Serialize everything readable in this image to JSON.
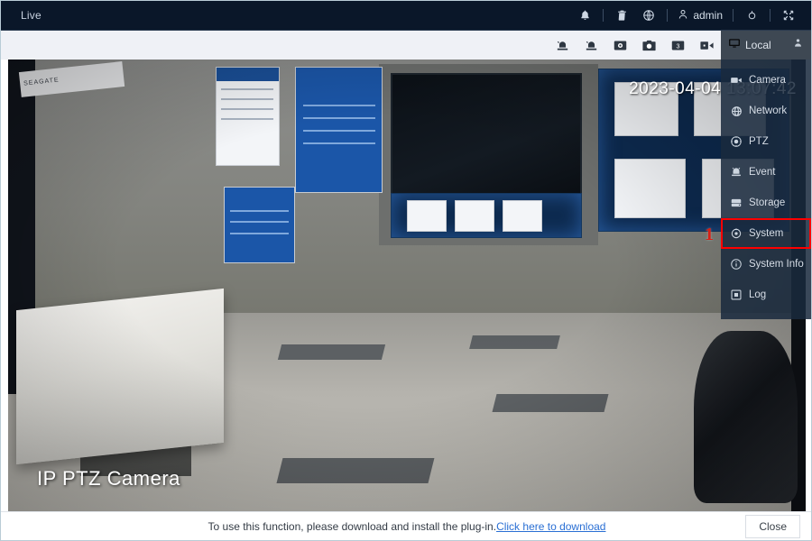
{
  "topbar": {
    "tab_label": "Live",
    "username": "admin",
    "icons": [
      {
        "name": "bell-icon",
        "title": "Alarm"
      },
      {
        "name": "trash-icon",
        "title": "Clear"
      },
      {
        "name": "globe-icon",
        "title": "Language"
      },
      {
        "name": "user-icon",
        "title": "Account"
      },
      {
        "name": "gear-icon",
        "title": "Settings"
      },
      {
        "name": "fullscreen-icon",
        "title": "Full Screen"
      }
    ]
  },
  "toolbar": {
    "icons": [
      {
        "name": "alarm-output-icon",
        "title": "Alarm Output 1"
      },
      {
        "name": "alarm-output-2-icon",
        "title": "Alarm Output 2"
      },
      {
        "name": "record-icon",
        "title": "Record"
      },
      {
        "name": "snapshot-icon",
        "title": "Snapshot"
      },
      {
        "name": "triple-snapshot-icon",
        "title": "Triple Snapshot",
        "badge": "3"
      },
      {
        "name": "playback-icon",
        "title": "Playback"
      }
    ]
  },
  "local_header": {
    "label": "Local",
    "monitor_icon": "monitor-icon",
    "person_icon": "person-icon"
  },
  "menu": {
    "items": [
      {
        "label": "Camera",
        "icon": "camera-icon",
        "highlighted": false
      },
      {
        "label": "Network",
        "icon": "globe-icon",
        "highlighted": false
      },
      {
        "label": "PTZ",
        "icon": "ptz-icon",
        "highlighted": false
      },
      {
        "label": "Event",
        "icon": "event-icon",
        "highlighted": false
      },
      {
        "label": "Storage",
        "icon": "storage-icon",
        "highlighted": false
      },
      {
        "label": "System",
        "icon": "system-gear-icon",
        "highlighted": true
      },
      {
        "label": "System Info",
        "icon": "info-icon",
        "highlighted": false
      },
      {
        "label": "Log",
        "icon": "log-icon",
        "highlighted": false
      }
    ],
    "highlight_color": "#ff0000"
  },
  "annotation": {
    "step_number": "1"
  },
  "video": {
    "timestamp": "2023-04-04 13:07:42",
    "channel_name": "IP PTZ Camera",
    "brand_label": "SEAGATE"
  },
  "plugin_bar": {
    "message": "To use this function, please download and install the plug-in.",
    "link_text": "Click here to download",
    "close_label": "Close"
  },
  "colors": {
    "topbar_bg": "#0a1729",
    "subbar_bg": "#eff1f6",
    "local_head_bg": "#3e4853",
    "menu_bg": "rgba(26,42,62,.86)",
    "accent_red": "#ff0000",
    "link_blue": "#2a6fd4"
  }
}
